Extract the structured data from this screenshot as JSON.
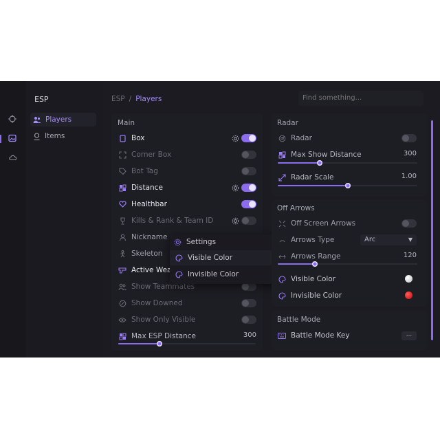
{
  "rail": {
    "icons": [
      "crosshair-icon",
      "image-icon",
      "cloud-icon"
    ]
  },
  "sidebar": {
    "title": "ESP",
    "items": [
      {
        "label": "Players",
        "icon": "users-icon",
        "active": true
      },
      {
        "label": "Items",
        "icon": "item-icon",
        "active": false
      }
    ]
  },
  "header": {
    "breadcrumb_root": "ESP",
    "breadcrumb_sep": "/",
    "breadcrumb_current": "Players",
    "search_placeholder": "Find something..."
  },
  "main_section": {
    "title": "Main",
    "rows": [
      {
        "label": "Box",
        "on": true,
        "gear": true
      },
      {
        "label": "Corner Box",
        "on": false,
        "gear": false
      },
      {
        "label": "Bot Tag",
        "on": false,
        "gear": false
      },
      {
        "label": "Distance",
        "on": true,
        "gear": true
      },
      {
        "label": "Healthbar",
        "on": true,
        "gear": false
      },
      {
        "label": "Kills & Rank & Team ID",
        "on": false,
        "gear": true
      },
      {
        "label": "Nickname",
        "on": false,
        "gear": false
      },
      {
        "label": "Skeleton",
        "on": false,
        "gear": false
      },
      {
        "label": "Active Weapon",
        "on": true,
        "gear": false
      },
      {
        "label": "Show Teammates",
        "on": false,
        "gear": false
      },
      {
        "label": "Show Downed",
        "on": false,
        "gear": false
      },
      {
        "label": "Show Only Visible",
        "on": false,
        "gear": false
      }
    ],
    "max_distance": {
      "label": "Max ESP Distance",
      "value": "300",
      "fill": 0.3
    }
  },
  "popup": {
    "title": "Settings",
    "items": [
      {
        "label": "Visible Color",
        "color": "#d9d9dd"
      },
      {
        "label": "Invisible Color",
        "color": "#e01212"
      }
    ]
  },
  "radar_section": {
    "title": "Radar",
    "radar": {
      "label": "Radar",
      "on": false
    },
    "max_show_distance": {
      "label": "Max Show Distance",
      "value": "300",
      "fill": 0.3
    },
    "radar_scale": {
      "label": "Radar Scale",
      "value": "1.00",
      "fill": 0.5
    }
  },
  "off_arrows_section": {
    "title": "Off Arrows",
    "off_screen": {
      "label": "Off Screen Arrows",
      "on": false
    },
    "arrows_type": {
      "label": "Arrows Type",
      "value": "Arc"
    },
    "arrows_range": {
      "label": "Arrows Range",
      "value": "120"
    },
    "visible_color": {
      "label": "Visible Color",
      "color": "#d9d9dd"
    },
    "invisible_color": {
      "label": "Invisible Color",
      "color": "#e01212"
    }
  },
  "battle_section": {
    "title": "Battle Mode",
    "key": {
      "label": "Battle Mode Key",
      "value": "..."
    }
  },
  "colors": {
    "accent": "#8b6cf0",
    "background": "#17171c"
  }
}
